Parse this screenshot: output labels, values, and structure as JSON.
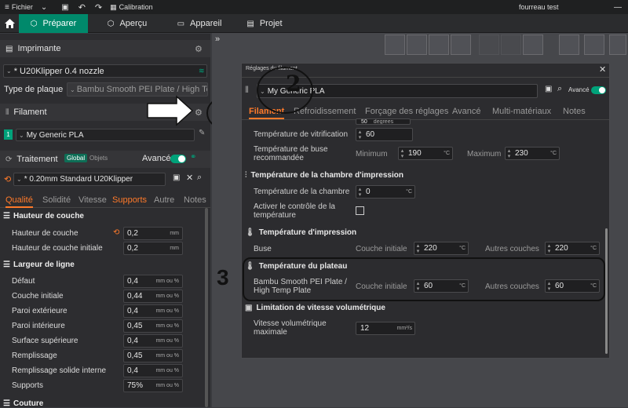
{
  "menubar": {
    "file": "Fichier",
    "calibration": "Calibration",
    "project_title": "fourreau test"
  },
  "tabs": {
    "prepare": "Préparer",
    "preview": "Aperçu",
    "device": "Appareil",
    "project": "Projet"
  },
  "left": {
    "printer_title": "Imprimante",
    "printer_name": "* U20Klipper 0.4 nozzle",
    "plate_label": "Type de plaque",
    "plate_value": "Bambu Smooth PEI Plate / High Te...",
    "filament_title": "Filament",
    "filament_index": "1",
    "filament_value": "My Generic PLA",
    "process_title": "Traitement",
    "global": "Global",
    "objects": "Objets",
    "advanced": "Avancé",
    "process_value": "* 0.20mm Standard U20Klipper",
    "qtabs": [
      "Qualité",
      "Solidité",
      "Vitesse",
      "Supports",
      "Autre",
      "Notes"
    ],
    "layer_height_section": "Hauteur de couche",
    "layer_rows": [
      {
        "label": "Hauteur de couche",
        "value": "0,2",
        "unit": "mm"
      },
      {
        "label": "Hauteur de couche initiale",
        "value": "0,2",
        "unit": "mm"
      }
    ],
    "line_width_section": "Largeur de ligne",
    "line_rows": [
      {
        "label": "Défaut",
        "value": "0,4",
        "unit": "mm ou %"
      },
      {
        "label": "Couche initiale",
        "value": "0,44",
        "unit": "mm ou %"
      },
      {
        "label": "Paroi extérieure",
        "value": "0,4",
        "unit": "mm ou %"
      },
      {
        "label": "Paroi intérieure",
        "value": "0,45",
        "unit": "mm ou %"
      },
      {
        "label": "Surface supérieure",
        "value": "0,4",
        "unit": "mm ou %"
      },
      {
        "label": "Remplissage",
        "value": "0,45",
        "unit": "mm ou %"
      },
      {
        "label": "Remplissage solide interne",
        "value": "0,4",
        "unit": "mm ou %"
      },
      {
        "label": "Supports",
        "value": "75%",
        "unit": "mm ou %"
      }
    ],
    "seam_section": "Couture"
  },
  "annotations": {
    "one": "1",
    "two": "2",
    "three": "3"
  },
  "dialog": {
    "title": "Réglages du filament",
    "preset": "My Generic PLA",
    "advanced": "Avancé",
    "tabs": [
      "Filament",
      "Refroidissement",
      "Forçage des réglages",
      "Avancé",
      "Multi-matériaux",
      "Notes"
    ],
    "partial_value": "50",
    "partial_unit": "degrees",
    "vitrification_label": "Température de vitrification",
    "vitrification_value": "60",
    "nozzle_range_label": "Température de buse recommandée",
    "min_label": "Minimum",
    "min_value": "190",
    "max_label": "Maximum",
    "max_value": "230",
    "deg": "°C",
    "chamber_section": "Température de la chambre d'impression",
    "chamber_label": "Température de la chambre",
    "chamber_value": "0",
    "chamber_ctrl_label": "Activer le contrôle de la température",
    "print_temp_section": "Température d'impression",
    "nozzle_label": "Buse",
    "initial_layer": "Couche initiale",
    "other_layers": "Autres couches",
    "nozzle_initial": "220",
    "nozzle_other": "220",
    "plate_section": "Température du plateau",
    "plate_label": "Bambu Smooth PEI Plate / High Temp Plate",
    "plate_initial": "60",
    "plate_other": "60",
    "volumetric_section": "Limitation de vitesse volumétrique",
    "volumetric_label": "Vitesse volumétrique maximale",
    "volumetric_value": "12",
    "volumetric_unit": "mm³/s"
  }
}
